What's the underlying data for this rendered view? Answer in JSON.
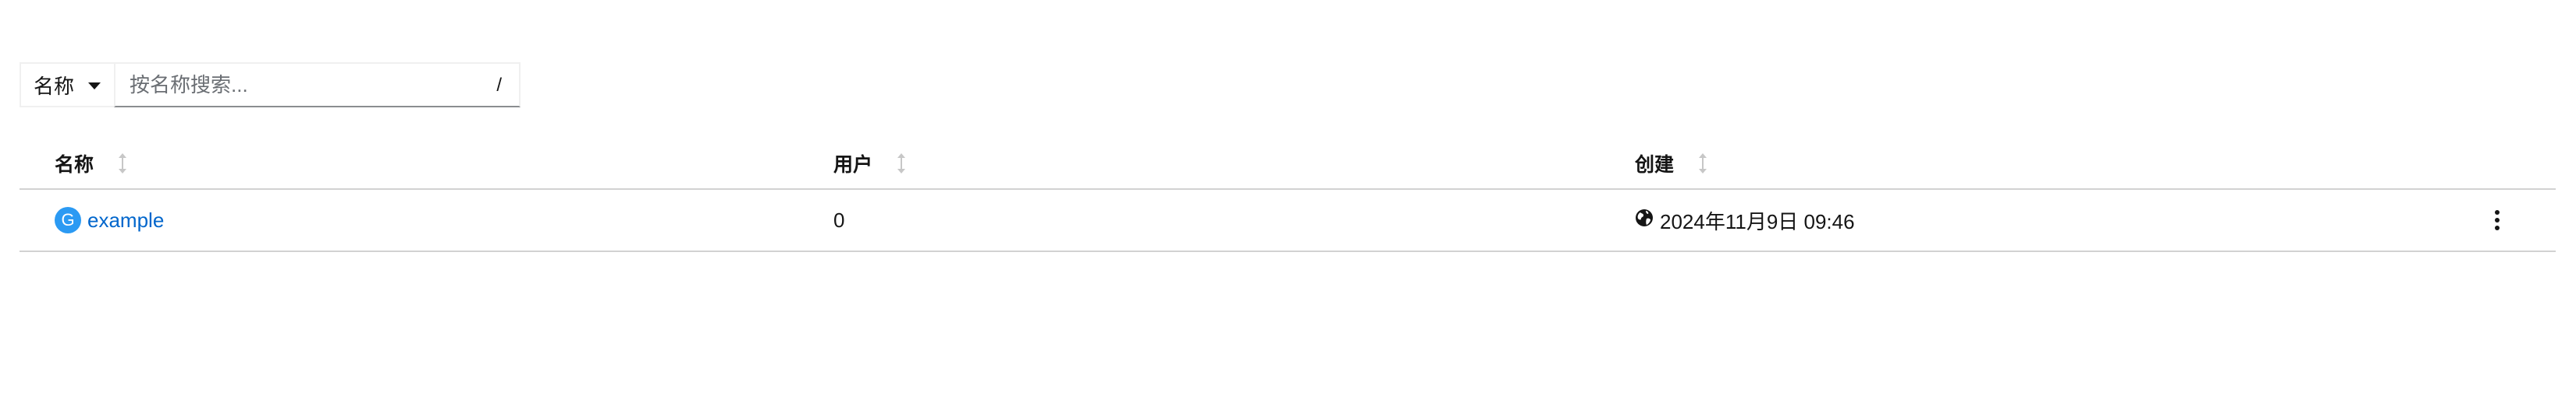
{
  "toolbar": {
    "filter_selected": "名称",
    "search_placeholder": "按名称搜索...",
    "search_shortcut": "/"
  },
  "table": {
    "columns": [
      {
        "label": "名称"
      },
      {
        "label": "用户"
      },
      {
        "label": "创建"
      }
    ],
    "rows": [
      {
        "provider_initial": "G",
        "name": "example",
        "users": "0",
        "created": "2024年11月9日 09:46"
      }
    ]
  },
  "colors": {
    "link": "#0066cc",
    "badge": "#2b9af3",
    "border": "#d2d2d2"
  },
  "icons": [
    "caret-down-icon",
    "sort-icon",
    "google-provider-icon",
    "globe-icon",
    "kebab-menu-icon"
  ]
}
